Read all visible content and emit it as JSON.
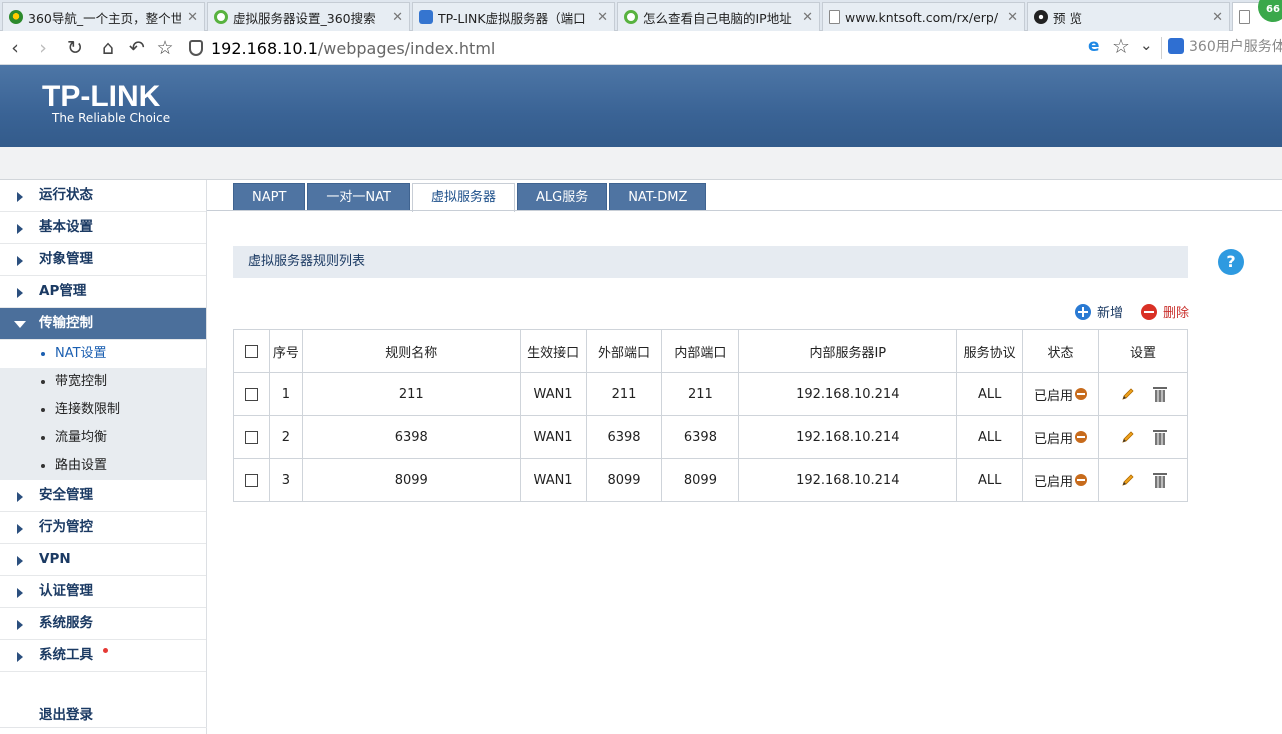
{
  "browser": {
    "tabs": [
      {
        "title": "360导航_一个主页，整个世",
        "icon": "360-icon"
      },
      {
        "title": "虚拟服务器设置_360搜索",
        "icon": "search-icon"
      },
      {
        "title": "TP-LINK虚拟服务器（端口",
        "icon": "paw-icon"
      },
      {
        "title": "怎么查看自己电脑的IP地址",
        "icon": "search-icon"
      },
      {
        "title": "www.kntsoft.com/rx/erp/",
        "icon": "document-icon"
      },
      {
        "title": "预 览",
        "icon": "preview-icon"
      }
    ],
    "badge": "66",
    "url_host": "192.168.10.1",
    "url_path": "/webpages/index.html",
    "search_placeholder": "360用户服务体"
  },
  "header": {
    "brand": "TP-LINK",
    "tagline": "The Reliable Choice"
  },
  "sidebar": {
    "items": [
      {
        "label": "运行状态"
      },
      {
        "label": "基本设置"
      },
      {
        "label": "对象管理"
      },
      {
        "label": "AP管理"
      },
      {
        "label": "传输控制",
        "open": true
      },
      {
        "label": "安全管理"
      },
      {
        "label": "行为管控"
      },
      {
        "label": "VPN"
      },
      {
        "label": "认证管理"
      },
      {
        "label": "系统服务"
      },
      {
        "label": "系统工具",
        "dot": true
      }
    ],
    "subitems": [
      {
        "label": "NAT设置",
        "active": true
      },
      {
        "label": "带宽控制"
      },
      {
        "label": "连接数限制"
      },
      {
        "label": "流量均衡"
      },
      {
        "label": "路由设置"
      }
    ],
    "logout": "退出登录"
  },
  "content_tabs": [
    "NAPT",
    "一对一NAT",
    "虚拟服务器",
    "ALG服务",
    "NAT-DMZ"
  ],
  "active_tab": "虚拟服务器",
  "panel": {
    "title": "虚拟服务器规则列表",
    "help": "?",
    "add_label": "新增",
    "delete_label": "删除"
  },
  "table": {
    "headers": [
      "序号",
      "规则名称",
      "生效接口",
      "外部端口",
      "内部端口",
      "内部服务器IP",
      "服务协议",
      "状态",
      "设置"
    ],
    "rows": [
      {
        "no": "1",
        "name": "211",
        "iface": "WAN1",
        "ext": "211",
        "int": "211",
        "ip": "192.168.10.214",
        "proto": "ALL",
        "status": "已启用"
      },
      {
        "no": "2",
        "name": "6398",
        "iface": "WAN1",
        "ext": "6398",
        "int": "6398",
        "ip": "192.168.10.214",
        "proto": "ALL",
        "status": "已启用"
      },
      {
        "no": "3",
        "name": "8099",
        "iface": "WAN1",
        "ext": "8099",
        "int": "8099",
        "ip": "192.168.10.214",
        "proto": "ALL",
        "status": "已启用"
      }
    ]
  },
  "colors": {
    "header_blue": "#3a6395",
    "tab_blue": "#4f74a2",
    "accent_link": "#1b5fb1",
    "delete_red": "#d93025",
    "status_orange": "#c76b1c"
  }
}
